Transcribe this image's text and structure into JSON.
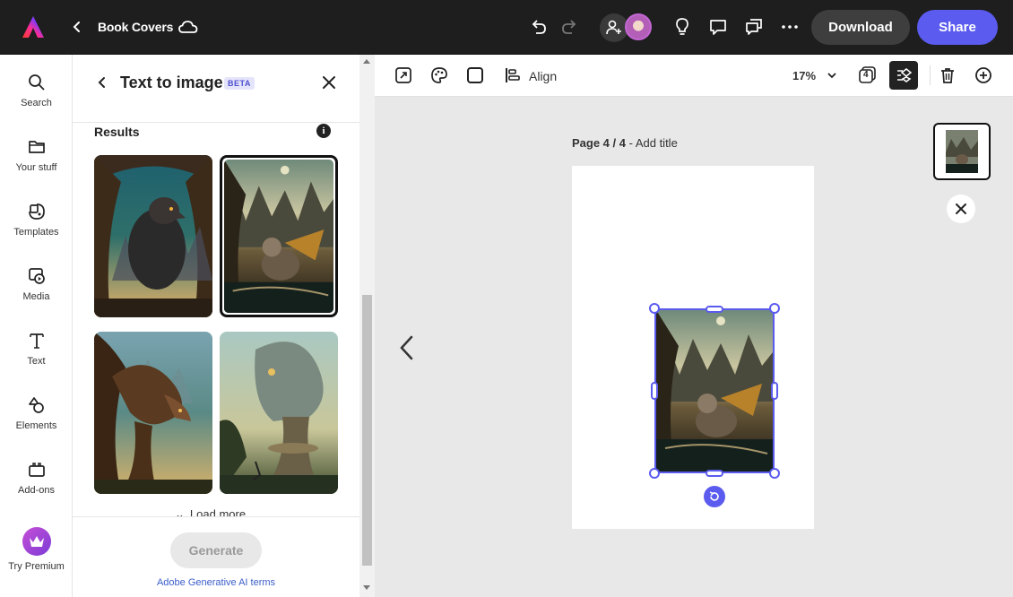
{
  "header": {
    "doc_title": "Book Covers",
    "download_label": "Download",
    "share_label": "Share",
    "icons": [
      "adobe-express-logo",
      "chevron-left-icon",
      "cloud-icon",
      "undo-icon",
      "redo-icon",
      "invite-person-icon",
      "avatar",
      "lightbulb-icon",
      "comment-icon",
      "chat-icon",
      "more-icon"
    ]
  },
  "rail": {
    "items": [
      {
        "label": "Search",
        "icon": "search-icon"
      },
      {
        "label": "Your stuff",
        "icon": "folder-icon"
      },
      {
        "label": "Templates",
        "icon": "templates-icon"
      },
      {
        "label": "Media",
        "icon": "media-icon"
      },
      {
        "label": "Text",
        "icon": "text-icon"
      },
      {
        "label": "Elements",
        "icon": "elements-icon"
      },
      {
        "label": "Add-ons",
        "icon": "add-ons-icon"
      },
      {
        "label": "Try Premium",
        "icon": "crown-icon"
      }
    ]
  },
  "panel": {
    "title": "Text to image",
    "badge": "BETA",
    "results_label": "Results",
    "load_more": "Load more",
    "generate_label": "Generate",
    "terms_link": "Adobe Generative AI terms",
    "results": [
      {
        "id": "result-1",
        "selected": false
      },
      {
        "id": "result-2",
        "selected": true
      },
      {
        "id": "result-3",
        "selected": false
      },
      {
        "id": "result-4",
        "selected": false
      }
    ]
  },
  "canvas": {
    "align_label": "Align",
    "zoom": "17%",
    "page_count_badge": "4",
    "page_label_prefix": "Page 4 / 4",
    "page_label_sep": " - ",
    "page_title_placeholder": "Add title"
  },
  "colors": {
    "accent": "#5b5bef",
    "topbar": "#1e1e1e",
    "canvas_bg": "#e8e8e8"
  }
}
